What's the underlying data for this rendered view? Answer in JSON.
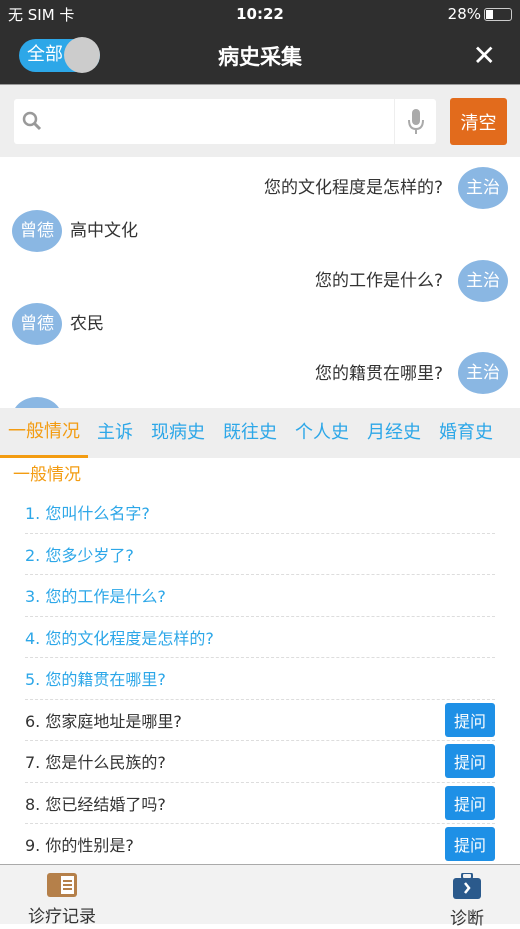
{
  "status": {
    "carrier": "无 SIM 卡",
    "time": "10:22",
    "battery": "28%",
    "battery_level": 28
  },
  "nav": {
    "toggle_label": "全部",
    "title": "病史采集",
    "close_icon": "close-icon"
  },
  "search": {
    "value": "",
    "placeholder": "",
    "clear_label": "清空"
  },
  "chat": [
    {
      "role": "doctor",
      "avatar": "主治",
      "text": "您的文化程度是怎样的?"
    },
    {
      "role": "patient",
      "avatar": "曾德",
      "text": "高中文化"
    },
    {
      "role": "doctor",
      "avatar": "主治",
      "text": "您的工作是什么?"
    },
    {
      "role": "patient",
      "avatar": "曾德",
      "text": "农民"
    },
    {
      "role": "doctor",
      "avatar": "主治",
      "text": "您的籍贯在哪里?"
    }
  ],
  "tabs": [
    "一般情况",
    "主诉",
    "现病史",
    "既往史",
    "个人史",
    "月经史",
    "婚育史"
  ],
  "active_tab": "一般情况",
  "section_title": "一般情况",
  "questions": [
    {
      "text": "1. 您叫什么名字?",
      "asked": true
    },
    {
      "text": "2. 您多少岁了?",
      "asked": true
    },
    {
      "text": "3. 您的工作是什么?",
      "asked": true
    },
    {
      "text": "4. 您的文化程度是怎样的?",
      "asked": true
    },
    {
      "text": "5. 您的籍贯在哪里?",
      "asked": true
    },
    {
      "text": "6. 您家庭地址是哪里?",
      "asked": false
    },
    {
      "text": "7. 您是什么民族的?",
      "asked": false
    },
    {
      "text": "8. 您已经结婚了吗?",
      "asked": false
    },
    {
      "text": "9. 你的性别是?",
      "asked": false
    }
  ],
  "ask_label": "提问",
  "bottom": {
    "records_label": "诊疗记录",
    "diagnosis_label": "诊断"
  },
  "colors": {
    "accent": "#2da7e8",
    "orange": "#f39c12",
    "clear": "#e26b1c",
    "avatar": "#8ab7e3"
  }
}
